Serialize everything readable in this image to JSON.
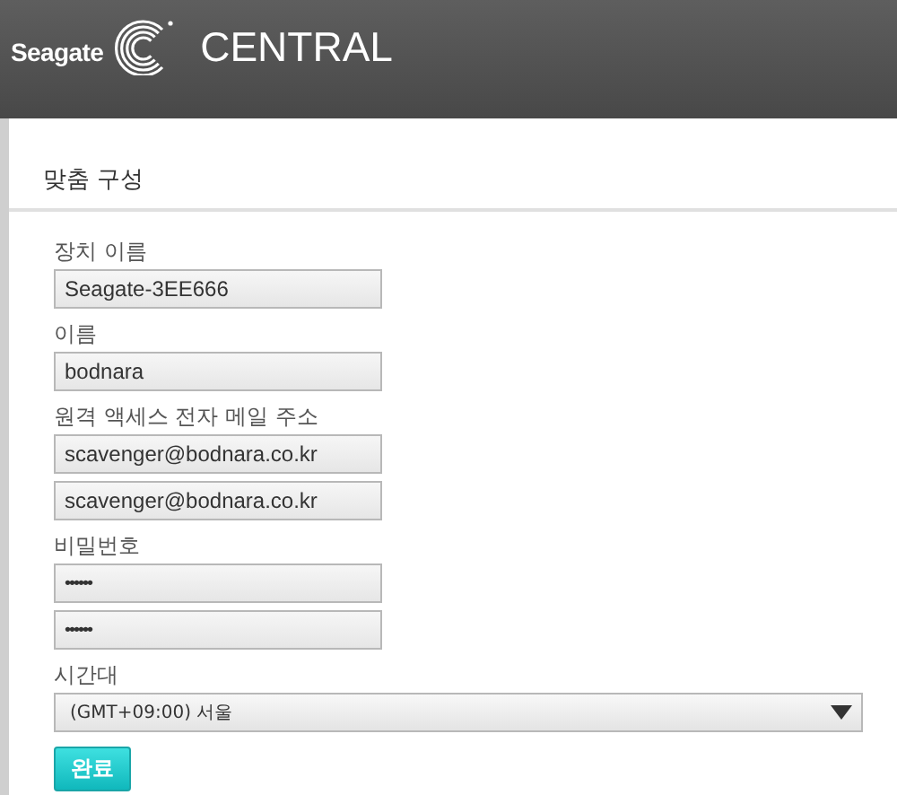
{
  "header": {
    "brand": "Seagate",
    "product": "CENTRAL"
  },
  "panel": {
    "title": "맞춤 구성"
  },
  "form": {
    "fields": [
      {
        "kind": "text",
        "label": "장치 이름",
        "value": "Seagate-3EE666"
      },
      {
        "kind": "text",
        "label": "이름",
        "value": "bodnara"
      },
      {
        "kind": "text",
        "label": "원격 액세스 전자 메일 주소",
        "value": "scavenger@bodnara.co.kr"
      },
      {
        "kind": "text",
        "value": "scavenger@bodnara.co.kr"
      },
      {
        "kind": "password",
        "label": "비밀번호",
        "value": "••••••"
      },
      {
        "kind": "password",
        "value": "••••••"
      },
      {
        "kind": "select",
        "label": "시간대",
        "value": "(GMT+09:00) 서울"
      }
    ],
    "submit": "완료"
  }
}
